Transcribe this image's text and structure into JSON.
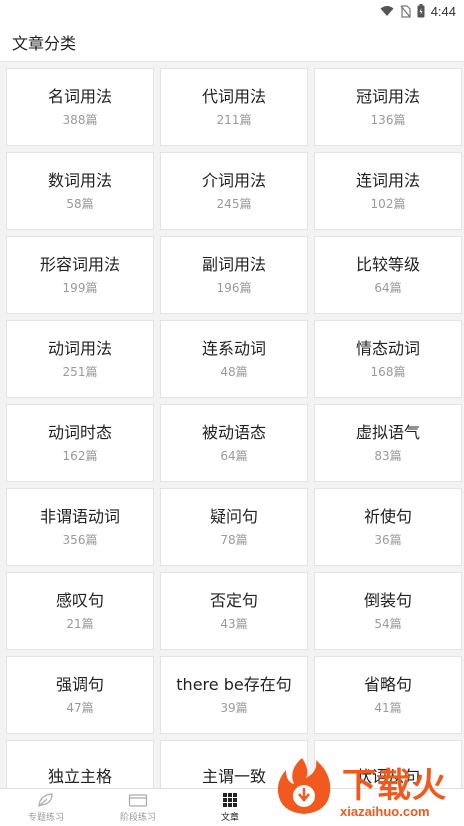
{
  "status_bar": {
    "time": "4:44"
  },
  "header": {
    "title": "文章分类"
  },
  "categories": [
    {
      "title": "名词用法",
      "count": "388篇"
    },
    {
      "title": "代词用法",
      "count": "211篇"
    },
    {
      "title": "冠词用法",
      "count": "136篇"
    },
    {
      "title": "数词用法",
      "count": "58篇"
    },
    {
      "title": "介词用法",
      "count": "245篇"
    },
    {
      "title": "连词用法",
      "count": "102篇"
    },
    {
      "title": "形容词用法",
      "count": "199篇"
    },
    {
      "title": "副词用法",
      "count": "196篇"
    },
    {
      "title": "比较等级",
      "count": "64篇"
    },
    {
      "title": "动词用法",
      "count": "251篇"
    },
    {
      "title": "连系动词",
      "count": "48篇"
    },
    {
      "title": "情态动词",
      "count": "168篇"
    },
    {
      "title": "动词时态",
      "count": "162篇"
    },
    {
      "title": "被动语态",
      "count": "64篇"
    },
    {
      "title": "虚拟语气",
      "count": "83篇"
    },
    {
      "title": "非谓语动词",
      "count": "356篇"
    },
    {
      "title": "疑问句",
      "count": "78篇"
    },
    {
      "title": "祈使句",
      "count": "36篇"
    },
    {
      "title": "感叹句",
      "count": "21篇"
    },
    {
      "title": "否定句",
      "count": "43篇"
    },
    {
      "title": "倒装句",
      "count": "54篇"
    },
    {
      "title": "强调句",
      "count": "47篇"
    },
    {
      "title": "there be存在句",
      "count": "39篇"
    },
    {
      "title": "省略句",
      "count": "41篇"
    },
    {
      "title": "独立主格",
      "count": ""
    },
    {
      "title": "主谓一致",
      "count": ""
    },
    {
      "title": "状语从句",
      "count": ""
    }
  ],
  "bottom_nav": [
    {
      "label": "专题练习",
      "icon": "leaf-icon",
      "active": false
    },
    {
      "label": "阶段练习",
      "icon": "folder-icon",
      "active": false
    },
    {
      "label": "文章",
      "icon": "grid-icon",
      "active": true
    }
  ],
  "watermark": {
    "brand": "下载火",
    "site": "xiazaihuo.com"
  },
  "colors": {
    "accent": "#f2591e",
    "count_text": "#9a9a9a",
    "background": "#f3f3f3"
  }
}
